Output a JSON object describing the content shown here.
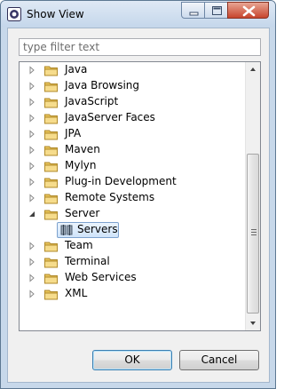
{
  "window": {
    "title": "Show View"
  },
  "filter": {
    "value": "",
    "placeholder": "type filter text"
  },
  "tree": {
    "items": [
      {
        "label": "Java",
        "expanded": false
      },
      {
        "label": "Java Browsing",
        "expanded": false
      },
      {
        "label": "JavaScript",
        "expanded": false
      },
      {
        "label": "JavaServer Faces",
        "expanded": false
      },
      {
        "label": "JPA",
        "expanded": false
      },
      {
        "label": "Maven",
        "expanded": false
      },
      {
        "label": "Mylyn",
        "expanded": false
      },
      {
        "label": "Plug-in Development",
        "expanded": false
      },
      {
        "label": "Remote Systems",
        "expanded": false
      },
      {
        "label": "Server",
        "expanded": true
      },
      {
        "label": "Team",
        "expanded": false
      },
      {
        "label": "Terminal",
        "expanded": false
      },
      {
        "label": "Web Services",
        "expanded": false
      },
      {
        "label": "XML",
        "expanded": false
      }
    ],
    "server_child": {
      "label": "Servers",
      "icon": "servers-icon",
      "selected": true
    }
  },
  "buttons": {
    "ok_label": "OK",
    "cancel_label": "Cancel"
  },
  "colors": {
    "folder": "#e7c35a",
    "selection": "#cfe4fa",
    "title_bar": "#c5d7eb"
  }
}
